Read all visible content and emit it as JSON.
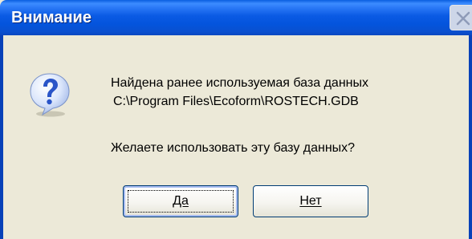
{
  "dialog": {
    "title": "Внимание",
    "message_line1": "Найдена ранее используемая база данных",
    "message_line2": "C:\\Program Files\\Ecoform\\ROSTECH.GDB",
    "question": "Желаете использовать эту базу данных?",
    "icon": "question-icon",
    "buttons": {
      "yes_label": "Да",
      "no_label": "Нет"
    }
  },
  "colors": {
    "titlebar": "#0a5ae4",
    "background": "#ece9d8",
    "frame": "#0841b8",
    "icon_blue": "#2a55c8"
  }
}
